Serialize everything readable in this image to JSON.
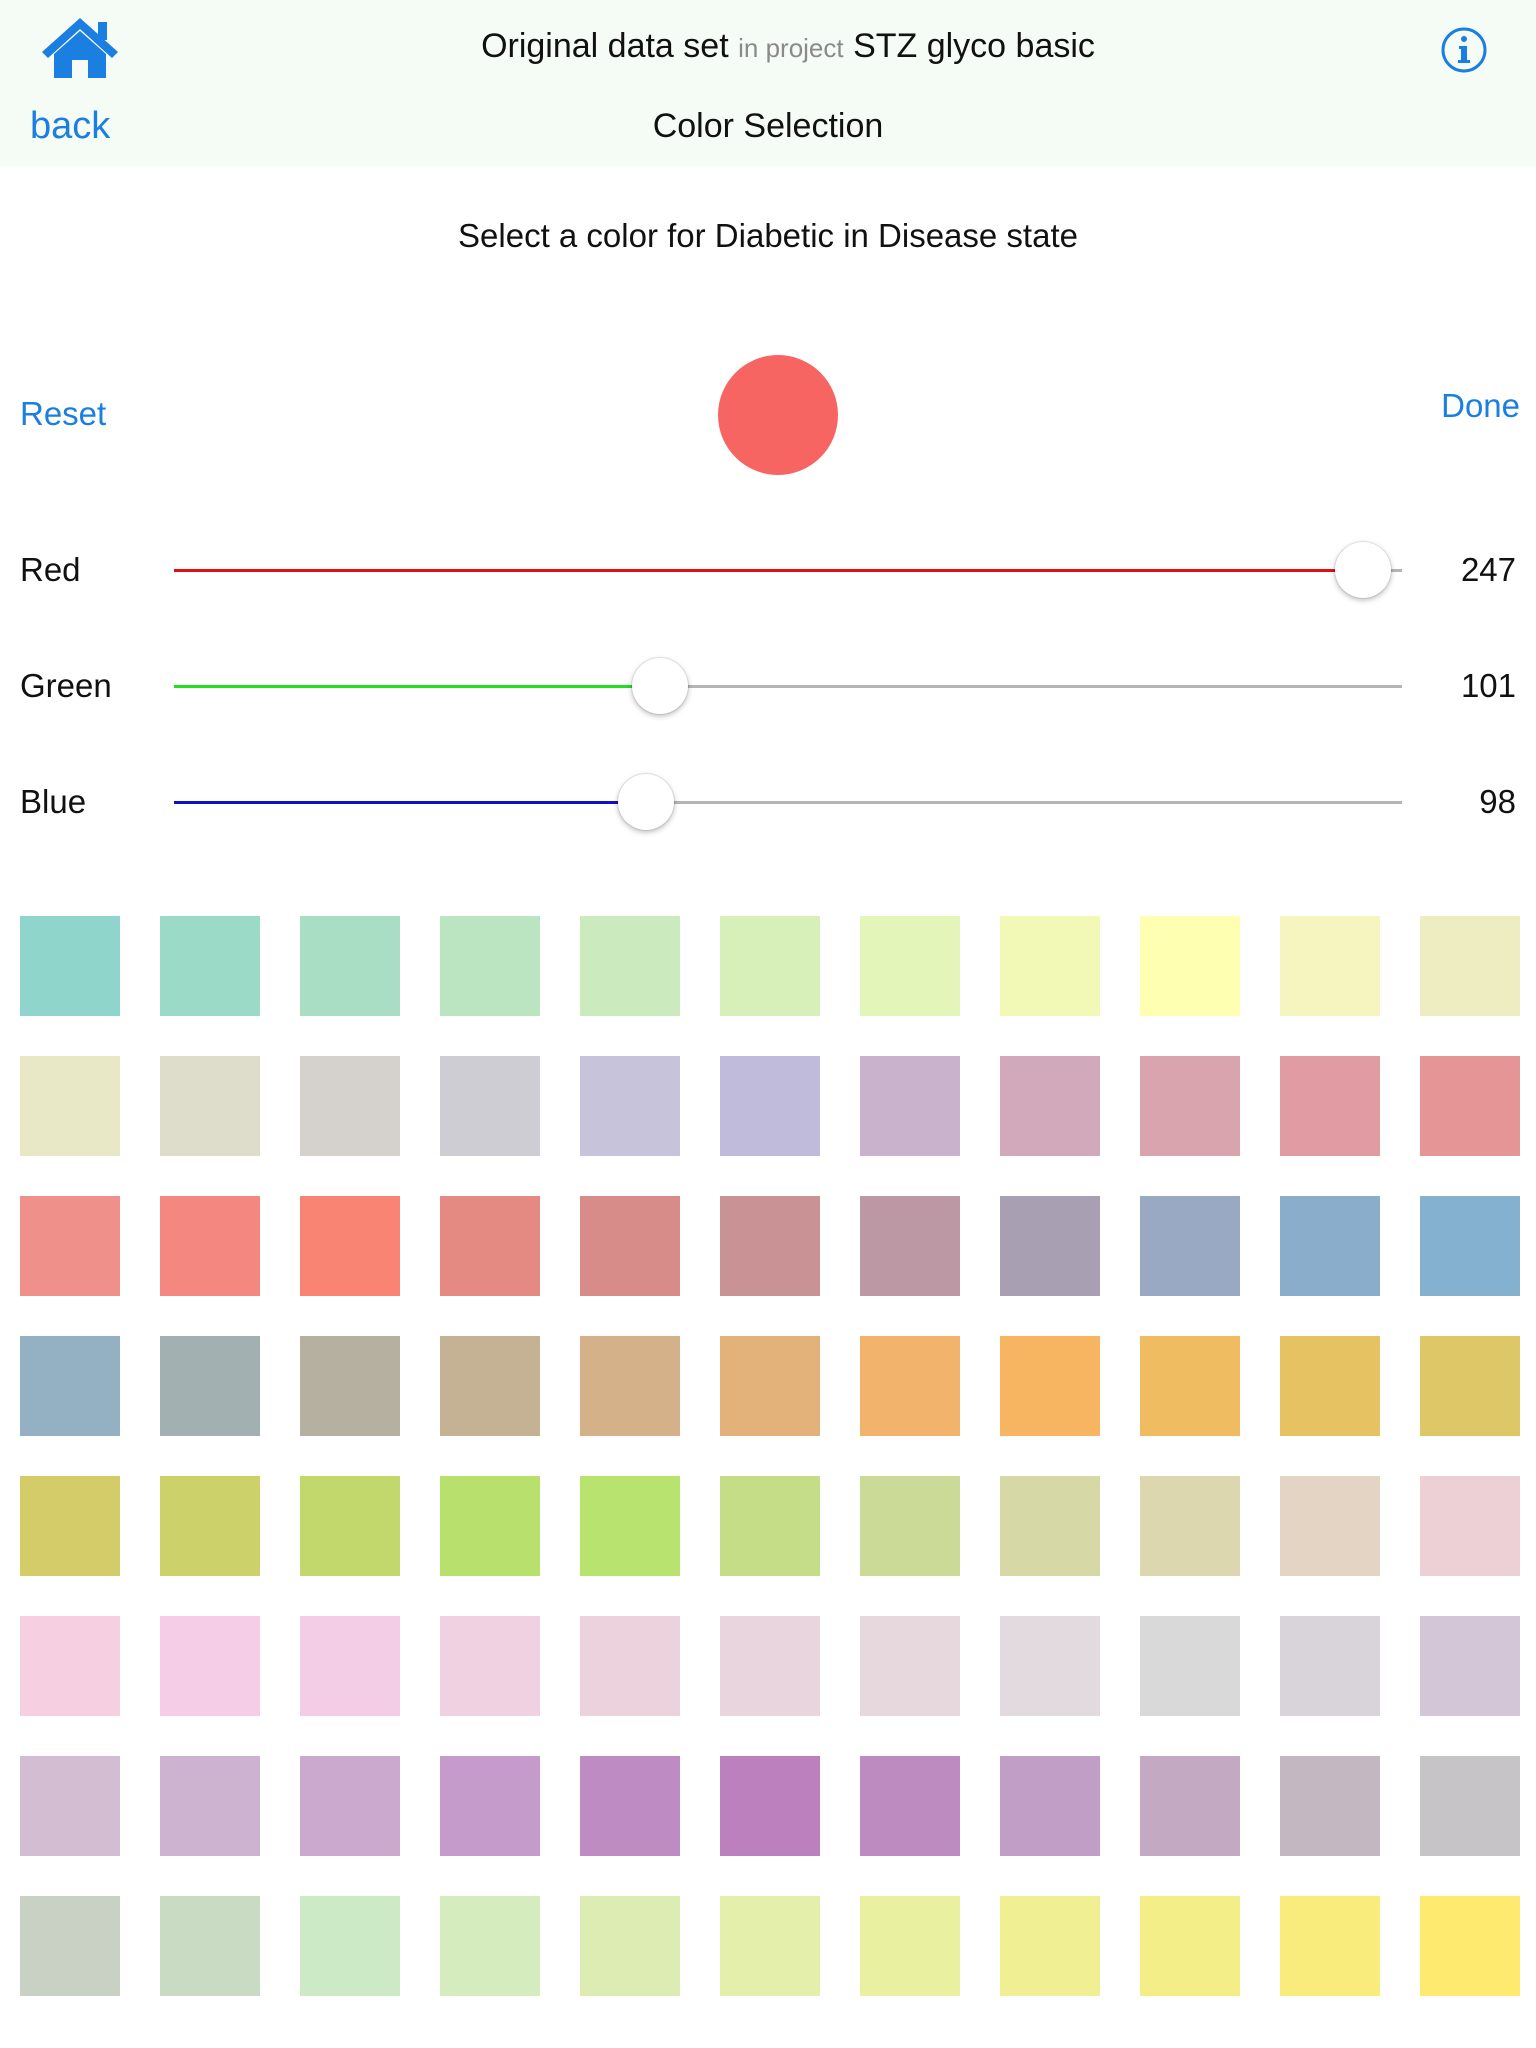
{
  "header": {
    "back_label": "back",
    "title_dataset": "Original data set",
    "title_in_project": "in project",
    "title_project": "STZ glyco basic",
    "subtitle": "Color Selection"
  },
  "prompt": "Select a color for Diabetic in Disease state",
  "actions": {
    "reset_label": "Reset",
    "done_label": "Done"
  },
  "current_color": "#f76562",
  "sliders": [
    {
      "label": "Red",
      "value": "247",
      "max": 255,
      "color": "#e01010"
    },
    {
      "label": "Green",
      "value": "101",
      "max": 255,
      "color": "#22dd22"
    },
    {
      "label": "Blue",
      "value": "98",
      "max": 255,
      "color": "#1010c8"
    }
  ],
  "palette": [
    [
      "#8fd5cb",
      "#9cdac8",
      "#a9dec4",
      "#bbe5c0",
      "#cbeabd",
      "#d7f0ba",
      "#e3f5b9",
      "#f2f9b6",
      "#ffffb2",
      "#f6f5bf",
      "#eeecc1"
    ],
    [
      "#e8e7c6",
      "#dedccb",
      "#d5d2ce",
      "#cecdd4",
      "#c6c3da",
      "#c0badb",
      "#c9b2cb",
      "#d2a9ba",
      "#daa4ae",
      "#e09ba3",
      "#e69597"
    ],
    [
      "#ef908b",
      "#f48780",
      "#fa8474",
      "#e58983",
      "#d78c8a",
      "#c99396",
      "#bb98a3",
      "#a99fb2",
      "#9aa9c3",
      "#8aadcc",
      "#84b1d0"
    ],
    [
      "#93b1c2",
      "#a3b0b1",
      "#b6b0a1",
      "#c5b295",
      "#d4b188",
      "#e3b27a",
      "#f2b46c",
      "#f7b461",
      "#efbc62",
      "#e6c262",
      "#ddc767"
    ],
    [
      "#d3cc68",
      "#cdd16a",
      "#c2d76c",
      "#b7e06c",
      "#b8e36f",
      "#c6dd88",
      "#ccda97",
      "#d6d8a6",
      "#ddd7b0",
      "#e3d4c3",
      "#edd0d5"
    ],
    [
      "#f6cfe0",
      "#f5cde6",
      "#f3cde5",
      "#efd1e1",
      "#ecd2dd",
      "#e9d5dd",
      "#e6d8dd",
      "#e3dadf",
      "#d9d9da",
      "#d9d3da",
      "#d3c6d6"
    ],
    [
      "#d2bdd3",
      "#ceb3d1",
      "#cba9cf",
      "#c49bcb",
      "#be8cc3",
      "#bb80bd",
      "#bd8bbf",
      "#c19ec5",
      "#c4a9c3",
      "#c3b7c2",
      "#c6c4c6"
    ],
    [
      "#c8d1c4",
      "#c9dcc3",
      "#cdeac6",
      "#d4ecbe",
      "#ddecb3",
      "#e3efaa",
      "#e9f0a0",
      "#f0ef93",
      "#f3ee88",
      "#f9ec7c",
      "#feea6f"
    ]
  ]
}
